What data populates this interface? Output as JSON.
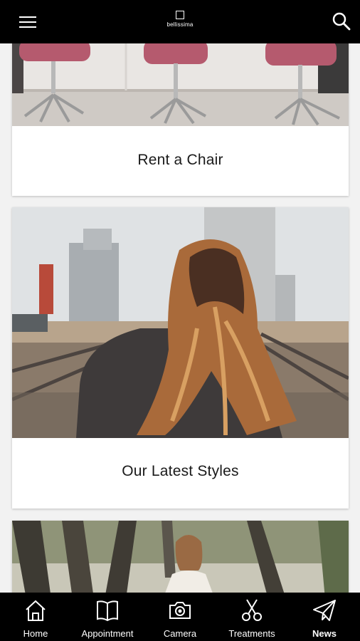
{
  "header": {
    "menu_icon": "hamburger-menu-icon",
    "logo_text": "bellissima",
    "search_icon": "search-icon"
  },
  "cards": [
    {
      "title": "Rent a Chair",
      "image": "salon-chairs-photo"
    },
    {
      "title": "Our Latest Styles",
      "image": "woman-long-hair-on-railway-photo"
    },
    {
      "title": "",
      "image": "bride-between-trees-photo"
    }
  ],
  "tabs": [
    {
      "label": "Home",
      "icon": "home-icon"
    },
    {
      "label": "Appointment",
      "icon": "book-icon"
    },
    {
      "label": "Camera",
      "icon": "camera-icon"
    },
    {
      "label": "Treatments",
      "icon": "scissors-icon"
    },
    {
      "label": "News",
      "icon": "paper-plane-icon",
      "active": true
    }
  ],
  "colors": {
    "bars": "#000000",
    "background": "#f2f2f2",
    "card": "#ffffff",
    "chair_seat": "#b55a6e"
  }
}
